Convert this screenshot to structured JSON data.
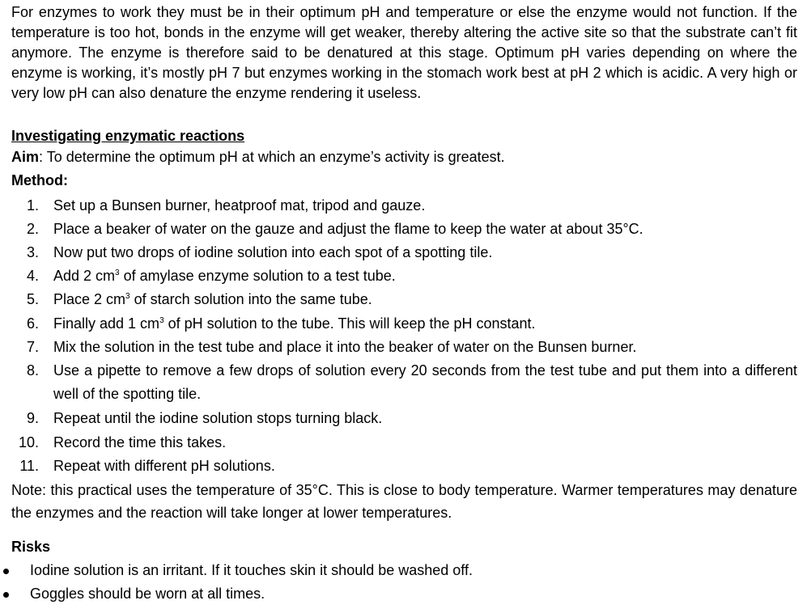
{
  "intro": "For enzymes to work they must be in their optimum pH and temperature or else the enzyme would not function. If the temperature is too hot, bonds in the enzyme will get weaker, thereby altering the active site so that the substrate can’t fit anymore. The enzyme is therefore said to be denatured at this stage. Optimum pH varies depending on where the enzyme is working, it’s mostly pH 7 but enzymes working in the stomach work best at pH 2 which is acidic. A very high or very low pH can also denature the enzyme rendering it useless.",
  "section_heading": "Investigating enzymatic reactions",
  "aim": {
    "label": "Aim",
    "text": ": To determine the optimum pH at which an enzyme’s activity is greatest."
  },
  "method_label": "Method:",
  "steps": [
    {
      "num": "1.",
      "text": "Set up a Bunsen burner, heatproof mat, tripod and gauze."
    },
    {
      "num": "2.",
      "text": "Place a beaker of water on the gauze and adjust the flame to keep the water at about 35°C."
    },
    {
      "num": "3.",
      "text": "Now put two drops of iodine solution into each spot of a spotting tile."
    },
    {
      "num": "4.",
      "pre": "Add 2 cm",
      "sup": "3",
      "post": " of amylase enzyme solution to a test tube."
    },
    {
      "num": "5.",
      "pre": "Place 2 cm",
      "sup": "3",
      "post": " of starch solution into the same tube."
    },
    {
      "num": "6.",
      "pre": "Finally add 1 cm",
      "sup": "3",
      "post": " of pH solution to the tube. This will keep the pH constant."
    },
    {
      "num": "7.",
      "text": "Mix the solution in the test tube and place it into the beaker of water on the Bunsen burner."
    },
    {
      "num": "8.",
      "text": "Use a pipette to remove a few drops of solution every 20 seconds from the test tube and put them into a different well of the spotting tile."
    },
    {
      "num": "9.",
      "text": "Repeat until the iodine solution stops turning black."
    },
    {
      "num": "10.",
      "text": "Record the time this takes."
    },
    {
      "num": "11.",
      "text": "Repeat with different pH solutions."
    }
  ],
  "note": "Note: this practical uses the temperature of 35°C. This is close to body temperature. Warmer temperatures may denature the enzymes and the reaction will take longer at lower temperatures.",
  "risks_heading": "Risks",
  "risks": [
    "Iodine solution is an irritant. If it touches skin it should be washed off.",
    "Goggles should be worn at all times."
  ]
}
